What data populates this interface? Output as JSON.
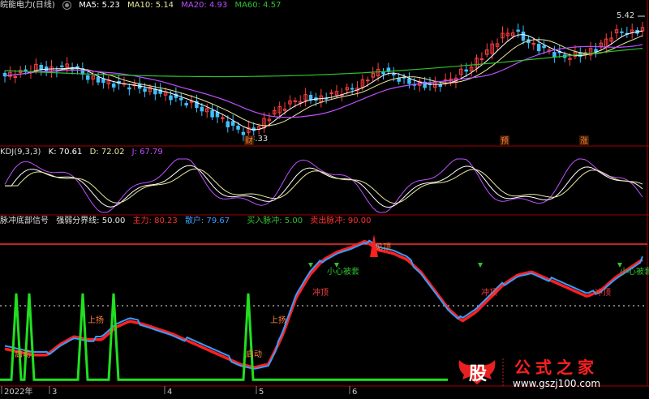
{
  "colors": {
    "up": "#ff4040",
    "down": "#40c0ff",
    "ma5": "#ffffff",
    "ma10": "#e8e8a0",
    "ma20": "#c050ff",
    "ma60": "#30c030",
    "frame": "#a00000",
    "green_signal": "#20e020",
    "blue_line": "#3a9cff",
    "red_line": "#ff2020"
  },
  "main_panel": {
    "title": "皖能电力(日线)",
    "ma5_label": "MA5: 5.23",
    "ma10_label": "MA10: 5.14",
    "ma20_label": "MA20: 4.93",
    "ma60_label": "MA60: 4.57",
    "high_mark": "5.42",
    "low_mark": "3.33",
    "event_marks": [
      "财",
      "预",
      "涨"
    ]
  },
  "kdj_panel": {
    "title": "KDJ(9,3,3)",
    "k_label": "K: 70.61",
    "d_label": "D: 72.02",
    "j_label": "J: 67.79"
  },
  "signal_panel": {
    "title": "脉冲底部信号",
    "threshold_label": "强弱分界线: 50.00",
    "main_label": "主力: 80.23",
    "retail_label": "散户: 79.67",
    "buy_label": "买入脉冲: 5.00",
    "sell_label": "卖出脉冲: 90.00",
    "annotations": [
      "启动",
      "上扬",
      "上扬",
      "启动",
      "见顶",
      "小心被套",
      "冲顶",
      "冲顶",
      "冲顶",
      "小心被套"
    ]
  },
  "x_axis": {
    "labels": [
      "2022年",
      "3",
      "4",
      "5",
      "6"
    ]
  },
  "watermark": {
    "logo_text": "股",
    "site_name": "公式之家",
    "url": "www.gszj100.com"
  },
  "chart_data": [
    {
      "type": "candlestick",
      "title": "皖能电力(日线)",
      "series_names": [
        "MA5",
        "MA10",
        "MA20",
        "MA60"
      ],
      "latest_values": {
        "MA5": 5.23,
        "MA10": 5.14,
        "MA20": 4.93,
        "MA60": 4.57
      },
      "annotations": {
        "max_price": 5.42,
        "min_price": 3.33
      },
      "close_path": [
        4.45,
        4.5,
        4.55,
        4.62,
        4.55,
        4.6,
        4.65,
        4.5,
        4.4,
        4.35,
        4.3,
        4.28,
        4.25,
        4.2,
        4.15,
        4.1,
        4.0,
        3.95,
        3.85,
        3.75,
        3.65,
        3.5,
        3.4,
        3.45,
        3.6,
        3.8,
        3.9,
        4.0,
        4.05,
        4.0,
        4.1,
        4.15,
        4.2,
        4.3,
        4.5,
        4.55,
        4.45,
        4.35,
        4.3,
        4.28,
        4.3,
        4.35,
        4.5,
        4.6,
        4.8,
        5.0,
        5.2,
        5.3,
        5.15,
        5.0,
        4.95,
        4.85,
        4.8,
        4.85,
        4.9,
        5.0,
        5.2,
        5.3,
        5.25,
        5.35
      ]
    },
    {
      "type": "line",
      "title": "KDJ(9,3,3)",
      "series_names": [
        "K",
        "D",
        "J"
      ],
      "latest_values": {
        "K": 70.61,
        "D": 72.02,
        "J": 67.79
      }
    },
    {
      "type": "line",
      "title": "脉冲底部信号",
      "series_names": [
        "强弱分界线",
        "主力",
        "散户",
        "买入脉冲",
        "卖出脉冲"
      ],
      "latest_values": {
        "强弱分界线": 50.0,
        "主力": 80.23,
        "散户": 79.67,
        "买入脉冲": 5.0,
        "卖出脉冲": 90.0
      }
    }
  ]
}
